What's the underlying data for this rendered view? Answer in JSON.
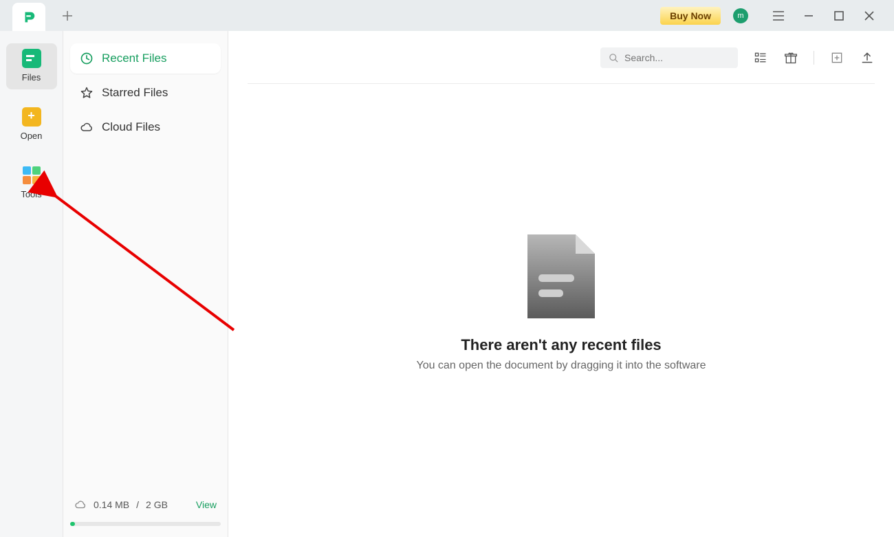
{
  "titlebar": {
    "buy_now": "Buy Now",
    "avatar_initial": "m"
  },
  "icon_rail": {
    "files": "Files",
    "open": "Open",
    "tools": "Tools"
  },
  "side": {
    "recent": "Recent Files",
    "starred": "Starred Files",
    "cloud": "Cloud Files"
  },
  "storage": {
    "used": "0.14 MB",
    "sep": "/",
    "total": "2 GB",
    "view": "View"
  },
  "search": {
    "placeholder": "Search..."
  },
  "empty": {
    "title": "There aren't any recent files",
    "sub": "You can open the document by dragging it into the software"
  }
}
